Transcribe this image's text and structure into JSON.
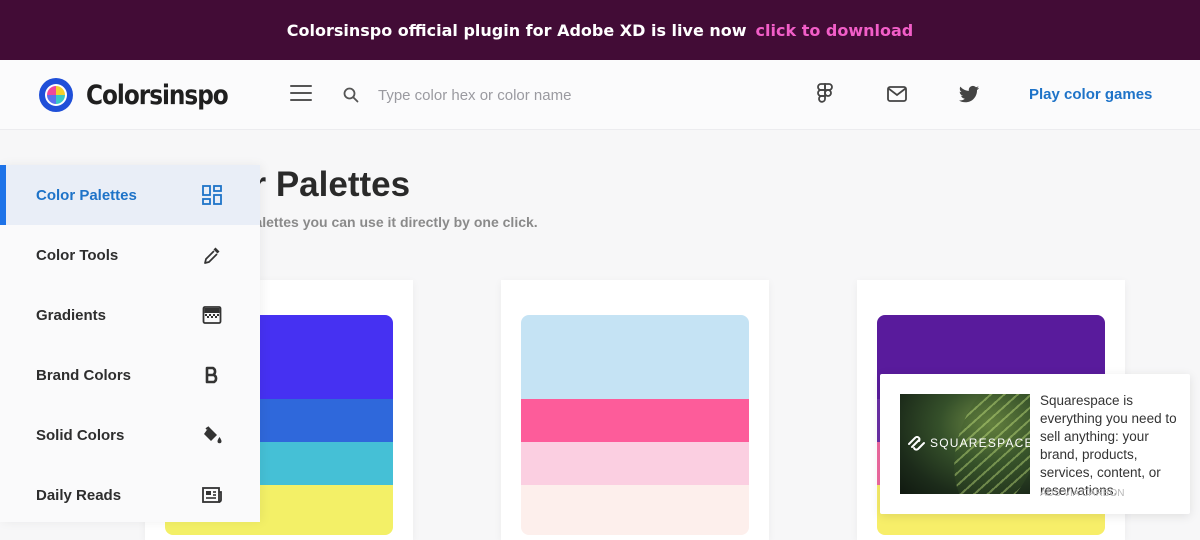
{
  "banner": {
    "text": "Colorsinspo official plugin for Adobe XD is live now",
    "link": "click to download",
    "bg_color": "#420c36",
    "link_color": "#f25ec8"
  },
  "header": {
    "logo_text": "Colorsinspo",
    "search_placeholder": "Type color hex or color name",
    "play_link": "Play color games",
    "icons": [
      "menu-icon",
      "search-icon",
      "figma-icon",
      "mail-icon",
      "twitter-icon"
    ]
  },
  "main": {
    "title": "olor Palettes",
    "subtitle": "l color palettes you can use it directly by one click."
  },
  "palettes": [
    {
      "colors": [
        "#4631f2",
        "#2f68db",
        "#45c0d6",
        "#f3f067"
      ]
    },
    {
      "colors": [
        "#c5e3f4",
        "#fd5c9a",
        "#fbcfe1",
        "#fdefec"
      ]
    },
    {
      "colors": [
        "#591b9c",
        "#6a2fa6",
        "#f06aa0",
        "#f7ee69"
      ]
    }
  ],
  "sidebar": {
    "items": [
      {
        "label": "Color Palettes",
        "icon": "grid-icon",
        "active": true
      },
      {
        "label": "Color Tools",
        "icon": "eyedropper-icon",
        "active": false
      },
      {
        "label": "Gradients",
        "icon": "gradient-icon",
        "active": false
      },
      {
        "label": "Brand Colors",
        "icon": "brand-b-icon",
        "active": false
      },
      {
        "label": "Solid Colors",
        "icon": "paint-bucket-icon",
        "active": false
      },
      {
        "label": "Daily Reads",
        "icon": "newspaper-icon",
        "active": false
      }
    ],
    "accent_color": "#1e73e8"
  },
  "ad": {
    "brand": "SQUARESPACE",
    "text": "Squarespace is everything you need to sell anything: your brand, products, services, content, or reservations.",
    "via": "ADS VIA CARBON"
  }
}
